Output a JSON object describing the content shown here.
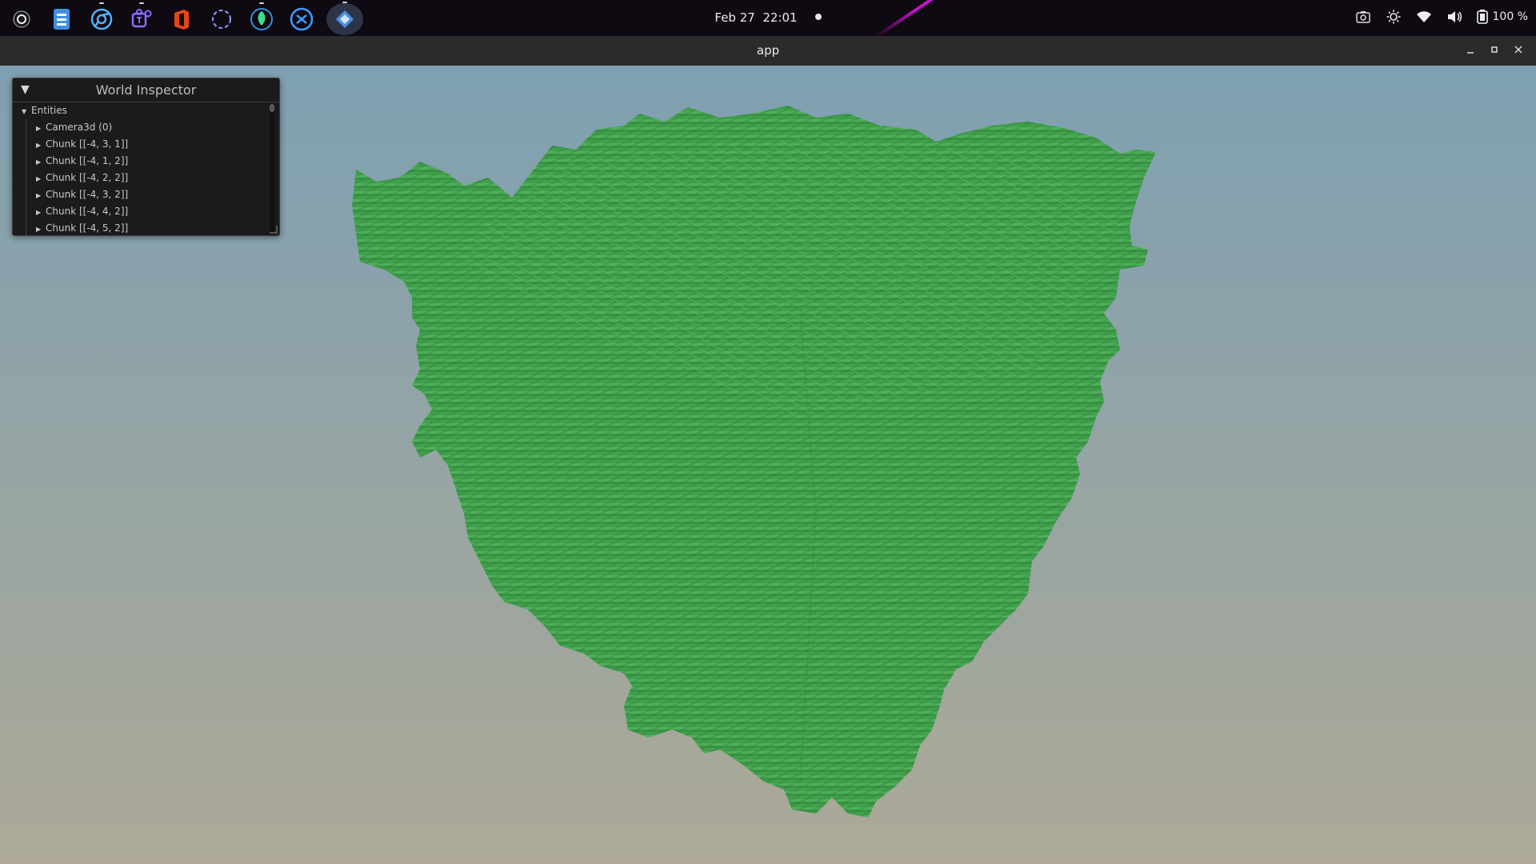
{
  "topbar": {
    "date": "Feb 27",
    "time": "22:01",
    "battery": "100 %",
    "dock_apps": [
      {
        "name": "activities-icon",
        "color": "#e8e8e8"
      },
      {
        "name": "files-icon",
        "color": "#4aa3ff"
      },
      {
        "name": "chrome-icon",
        "color": "#4fb3ff"
      },
      {
        "name": "teams-icon",
        "color": "#7b5cff"
      },
      {
        "name": "office-icon",
        "color": "#e8431a"
      },
      {
        "name": "screenshot-icon",
        "color": "#8a9cff"
      },
      {
        "name": "app-icon",
        "color": "#3ddc84"
      },
      {
        "name": "vscode-icon",
        "color": "#3b9cff"
      },
      {
        "name": "active-app-icon",
        "color": "#4a90e2"
      }
    ]
  },
  "window": {
    "title": "app"
  },
  "inspector": {
    "title": "World Inspector",
    "root_label": "Entities",
    "items": [
      "Camera3d (0)",
      "Chunk [[-4, 3, 1]]",
      "Chunk [[-4, 1, 2]]",
      "Chunk [[-4, 2, 2]]",
      "Chunk [[-4, 3, 2]]",
      "Chunk [[-4, 4, 2]]",
      "Chunk [[-4, 5, 2]]"
    ]
  },
  "scene": {
    "sky_top": "#7ea0b2",
    "sky_bottom": "#ada996",
    "voxel_color": "#3f9e4a",
    "voxel_dark": "#2f7f39",
    "voxel_light": "#55b65c"
  }
}
